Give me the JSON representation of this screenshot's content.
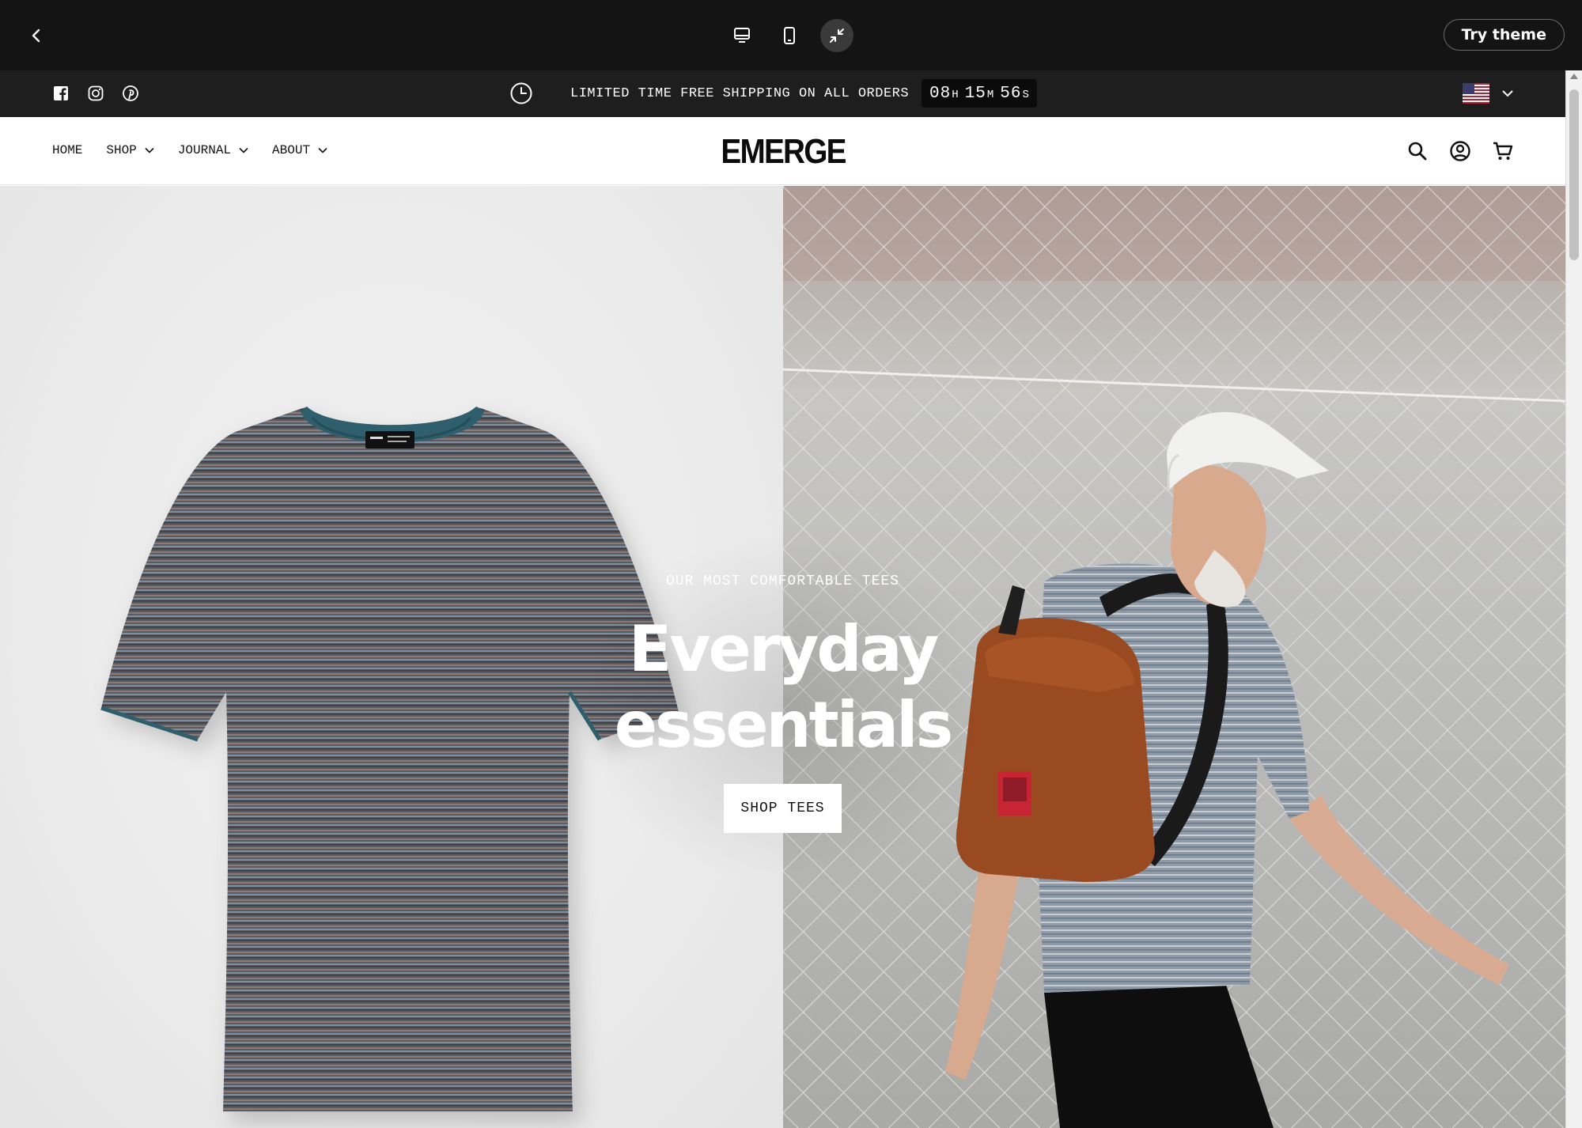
{
  "preview_bar": {
    "try_theme_label": "Try theme",
    "colors": {
      "background": "#141414",
      "active_button": "#3a3a3a"
    }
  },
  "announcement": {
    "text": "LIMITED TIME FREE SHIPPING ON ALL ORDERS",
    "timer": {
      "hours": "08",
      "hours_unit": "H",
      "minutes": "15",
      "minutes_unit": "M",
      "seconds": "56",
      "seconds_unit": "S"
    },
    "social_icons": [
      "facebook-icon",
      "instagram-icon",
      "pinterest-icon"
    ],
    "country": "us-flag-icon"
  },
  "header": {
    "logo": "EMERGE",
    "nav": [
      {
        "label": "HOME",
        "has_dropdown": false
      },
      {
        "label": "SHOP",
        "has_dropdown": true
      },
      {
        "label": "JOURNAL",
        "has_dropdown": true
      },
      {
        "label": "ABOUT",
        "has_dropdown": true
      }
    ],
    "icons": [
      "search-icon",
      "account-icon",
      "cart-icon"
    ]
  },
  "hero": {
    "eyebrow": "OUR MOST COMFORTABLE TEES",
    "headline_line1": "Everyday",
    "headline_line2": "essentials",
    "cta_label": "SHOP TEES",
    "colors": {
      "left_bg": "#ececec",
      "tee_body": "#4f5258",
      "tee_collar": "#2f5f6c",
      "backpack": "#9a4a20"
    }
  }
}
